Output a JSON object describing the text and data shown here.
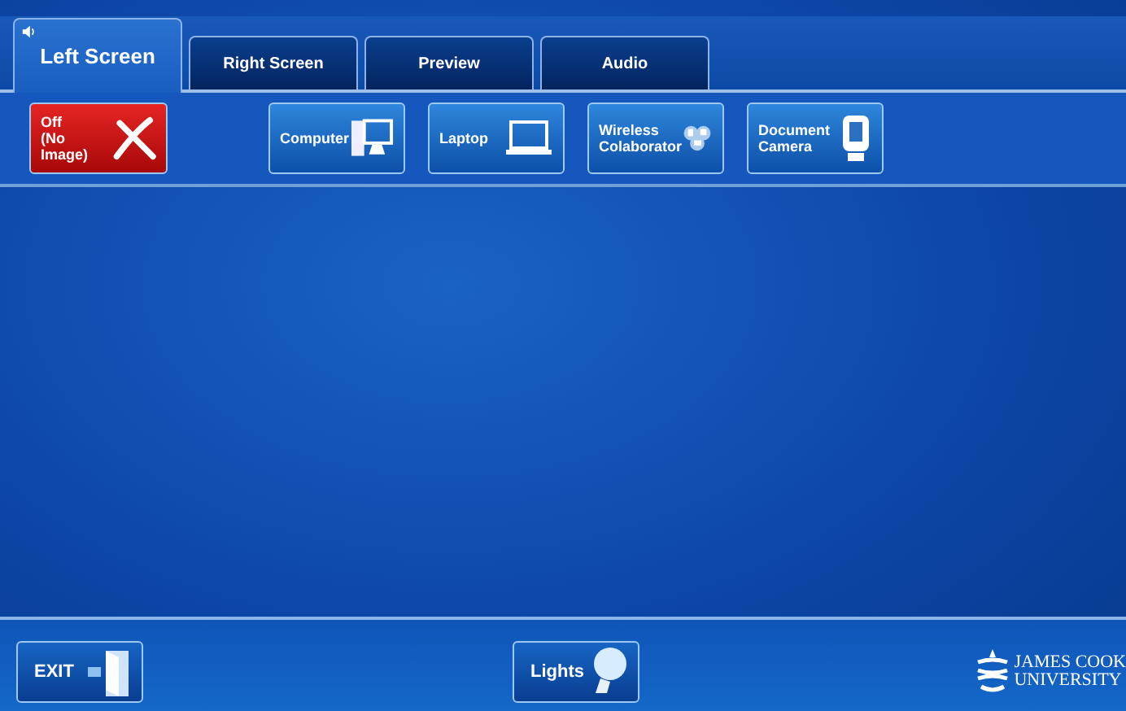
{
  "tabs": [
    {
      "label": "Left Screen",
      "selected": true,
      "audio": true
    },
    {
      "label": "Right Screen",
      "selected": false,
      "audio": false
    },
    {
      "label": "Preview",
      "selected": false,
      "audio": false
    },
    {
      "label": "Audio",
      "selected": false,
      "audio": false
    }
  ],
  "sources": [
    {
      "kind": "off",
      "lines": [
        "Off",
        "(No Image)"
      ]
    },
    {
      "kind": "computer",
      "lines": [
        "Computer"
      ]
    },
    {
      "kind": "laptop",
      "lines": [
        "Laptop"
      ]
    },
    {
      "kind": "wireless",
      "lines": [
        "Wireless",
        "Colaborator"
      ]
    },
    {
      "kind": "camera",
      "lines": [
        "Document",
        "Camera"
      ]
    }
  ],
  "footer": {
    "exit": "EXIT",
    "lights": "Lights",
    "logo": [
      "JAMES COOK",
      "UNIVERSITY"
    ]
  }
}
